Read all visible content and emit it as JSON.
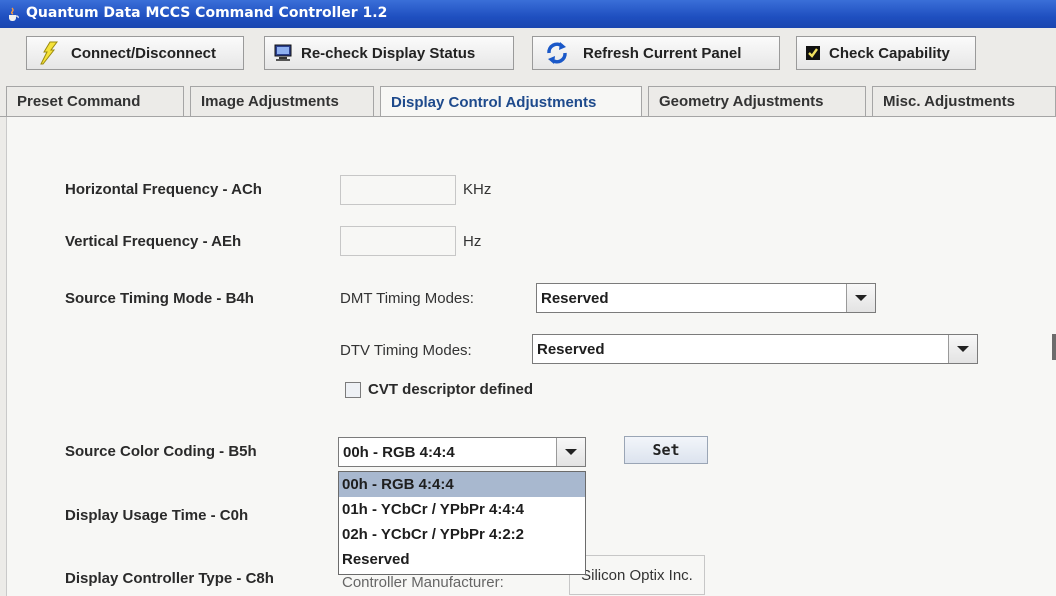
{
  "window": {
    "title": "Quantum Data MCCS Command Controller 1.2",
    "icon": "java-cup-icon"
  },
  "toolbar": {
    "connect": {
      "label": "Connect/Disconnect",
      "icon": "lightning-icon"
    },
    "recheck": {
      "label": "Re-check Display Status",
      "icon": "monitor-icon"
    },
    "refresh": {
      "label": "Refresh Current Panel",
      "icon": "refresh-arrows-icon"
    },
    "capability": {
      "label": "Check Capability",
      "icon": "checkbox-icon"
    }
  },
  "tabs": [
    {
      "label": "Preset Command",
      "active": false
    },
    {
      "label": "Image Adjustments",
      "active": false
    },
    {
      "label": "Display Control Adjustments",
      "active": true
    },
    {
      "label": "Geometry Adjustments",
      "active": false
    },
    {
      "label": "Misc. Adjustments",
      "active": false
    }
  ],
  "panel": {
    "hfreq": {
      "label": "Horizontal Frequency - ACh",
      "value": "",
      "unit": "KHz"
    },
    "vfreq": {
      "label": "Vertical Frequency - AEh",
      "value": "",
      "unit": "Hz"
    },
    "timing": {
      "label": "Source Timing Mode - B4h",
      "dmt_label": "DMT Timing Modes:",
      "dmt_value": "Reserved",
      "dtv_label": "DTV Timing Modes:",
      "dtv_value": "Reserved",
      "cvt_label": "CVT descriptor defined",
      "cvt_checked": false
    },
    "color": {
      "label": "Source Color Coding - B5h",
      "value": "00h - RGB 4:4:4",
      "set_label": "Set",
      "options": [
        "00h - RGB 4:4:4",
        "01h - YCbCr / YPbPr 4:4:4",
        "02h - YCbCr / YPbPr 4:2:2",
        "Reserved"
      ],
      "selected_index": 0
    },
    "usage": {
      "label": "Display Usage Time - C0h"
    },
    "controller": {
      "label": "Display Controller Type - C8h",
      "manufacturer_label": "Controller Manufacturer:",
      "manufacturer_value": "Silicon Optix Inc."
    }
  },
  "colors": {
    "title_bar": "#1f4fc0",
    "active_tab_text": "#1e4a8c",
    "selection": "#a8b8cf"
  }
}
